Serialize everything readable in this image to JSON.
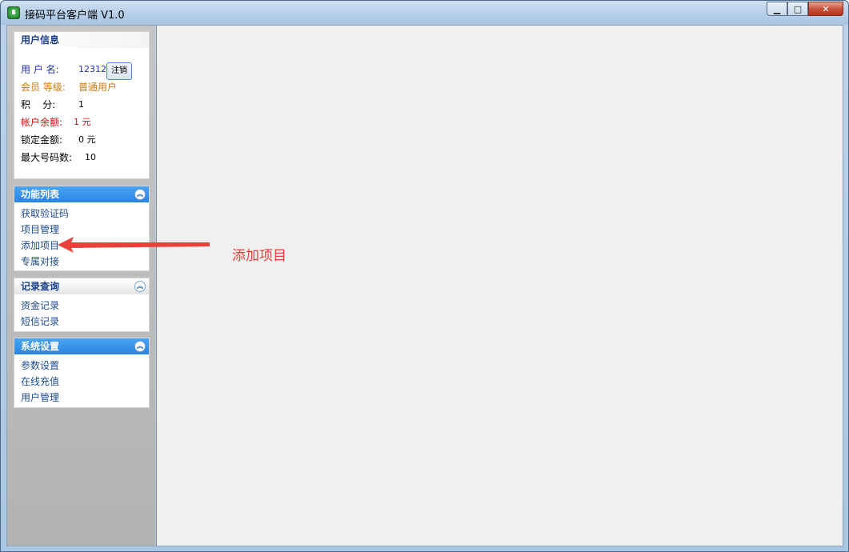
{
  "window": {
    "title": "接码平台客户端 V1.0",
    "minimize_glyph": "▁",
    "maximize_glyph": "□",
    "close_glyph": "✕"
  },
  "user_info": {
    "header": "用户信息",
    "username_label": "用 户 名:",
    "username_value": "123123",
    "logout_label": "注销",
    "level_label": "会员 等级:",
    "level_value": "普通用户",
    "points_label": "积    分:",
    "points_value": "1",
    "balance_label": "帐户余额:",
    "balance_value": "1 元",
    "locked_label": "锁定金额:",
    "locked_value": "0 元",
    "max_numbers_label": "最大号码数:",
    "max_numbers_value": "10"
  },
  "function_list": {
    "header": "功能列表",
    "items": [
      "获取验证码",
      "项目管理",
      "添加项目",
      "专属对接"
    ]
  },
  "records": {
    "header": "记录查询",
    "items": [
      "资金记录",
      "短信记录"
    ]
  },
  "settings": {
    "header": "系统设置",
    "items": [
      "参数设置",
      "在线充值",
      "用户管理"
    ]
  },
  "annotation": {
    "text": "添加项目",
    "color": "#e8413a"
  },
  "collapse_glyph": "︽"
}
